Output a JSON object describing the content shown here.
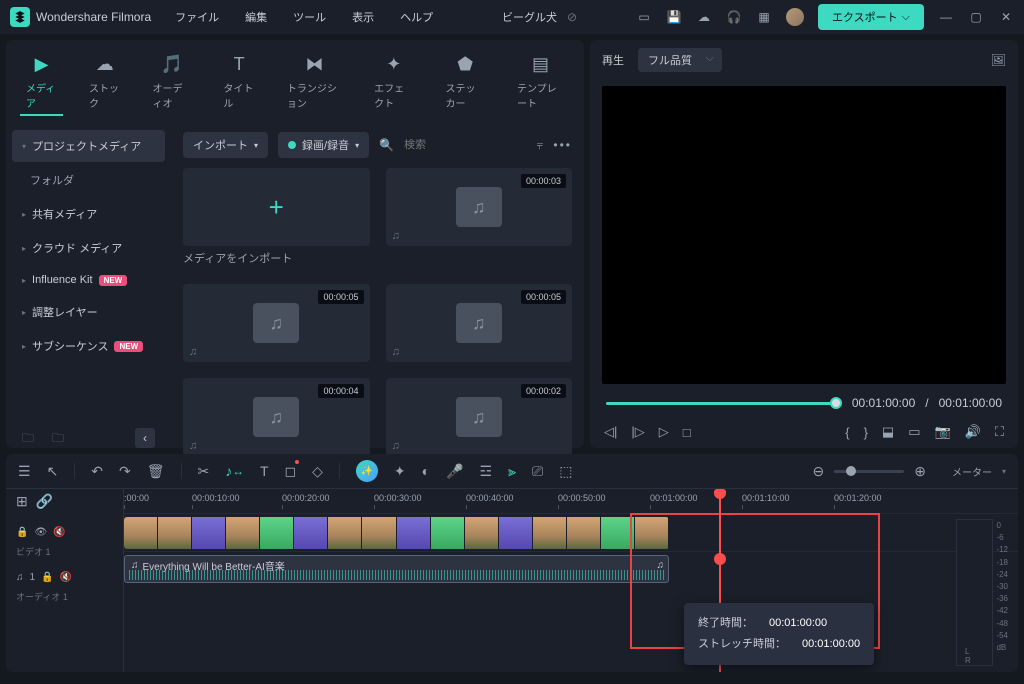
{
  "app": {
    "title": "Wondershare Filmora"
  },
  "menu": [
    "ファイル",
    "編集",
    "ツール",
    "表示",
    "ヘルプ"
  ],
  "search": {
    "text": "ビーグル犬"
  },
  "export": {
    "label": "エクスポート"
  },
  "tabs": [
    {
      "label": "メディア"
    },
    {
      "label": "ストック"
    },
    {
      "label": "オーディオ"
    },
    {
      "label": "タイトル"
    },
    {
      "label": "トランジション"
    },
    {
      "label": "エフェクト"
    },
    {
      "label": "ステッカー"
    },
    {
      "label": "テンプレート"
    }
  ],
  "sidebar": {
    "project": "プロジェクトメディア",
    "folder": "フォルダ",
    "items": [
      {
        "label": "共有メディア"
      },
      {
        "label": "クラウド メディア"
      },
      {
        "label": "Influence Kit",
        "badge": "NEW"
      },
      {
        "label": "調整レイヤー"
      },
      {
        "label": "サブシーケンス",
        "badge": "NEW"
      }
    ]
  },
  "toolbar": {
    "import": "インポート",
    "record": "録画/録音",
    "search_ph": "検索"
  },
  "import_text": "メディアをインポート",
  "media": [
    {
      "dur": "00:00:03"
    },
    {
      "dur": "00:00:05"
    },
    {
      "dur": "00:00:05"
    },
    {
      "dur": "00:00:04"
    },
    {
      "dur": "00:00:02"
    }
  ],
  "preview": {
    "label": "再生",
    "quality": "フル品質",
    "cur": "00:01:00:00",
    "sep": "/",
    "total": "00:01:00:00"
  },
  "ruler": [
    ":00:00",
    "00:00:10:00",
    "00:00:20:00",
    "00:00:30:00",
    "00:00:40:00",
    "00:00:50:00",
    "00:01:00:00",
    "00:01:10:00",
    "00:01:20:00"
  ],
  "tracks": {
    "video": "ビデオ 1",
    "audio": "オーディオ 1",
    "audio_badges": "1"
  },
  "audio_clip": "Everything Will be Better-AI音楽",
  "tooltip": {
    "end_label": "終了時間：",
    "end_val": "00:01:00:00",
    "stretch_label": "ストレッチ時間：",
    "stretch_val": "00:01:00:00"
  },
  "meter": {
    "label": "メーター",
    "unit": "dB",
    "lr": "L  R"
  },
  "db": [
    "0",
    "-6",
    "-12",
    "-18",
    "-24",
    "-30",
    "-36",
    "-42",
    "-48",
    "-54"
  ]
}
